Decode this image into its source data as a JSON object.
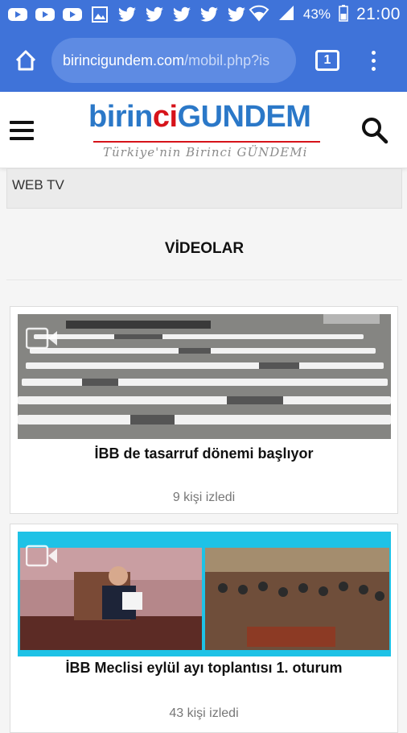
{
  "status_bar": {
    "notification_icons": [
      "youtube-icon",
      "youtube-icon",
      "youtube-icon",
      "gallery-icon",
      "twitter-icon",
      "twitter-icon",
      "twitter-icon",
      "twitter-icon",
      "twitter-icon"
    ],
    "battery": "43%",
    "time": "21:00"
  },
  "browser": {
    "url_host": "birincigundem.com",
    "url_path": "/mobil.php?is",
    "tab_count": "1"
  },
  "site": {
    "logo_part1": "birin",
    "logo_part2": "ci",
    "logo_part3": "GUNDEM",
    "logo_tagline": "Türkiye'nin Birinci GÜNDEMi"
  },
  "section": {
    "tab_label": "WEB TV",
    "heading": "VİDEOLAR"
  },
  "videos": [
    {
      "title": "İBB de tasarruf dönemi başlıyor",
      "views": "9 kişi izledi"
    },
    {
      "title": "İBB Meclisi eylül ayı toplantısı 1. oturum",
      "views": "43 kişi izledi"
    }
  ],
  "colors": {
    "browser_blue": "#3f73d9",
    "logo_blue": "#2b78c8",
    "logo_red": "#d6131a"
  }
}
